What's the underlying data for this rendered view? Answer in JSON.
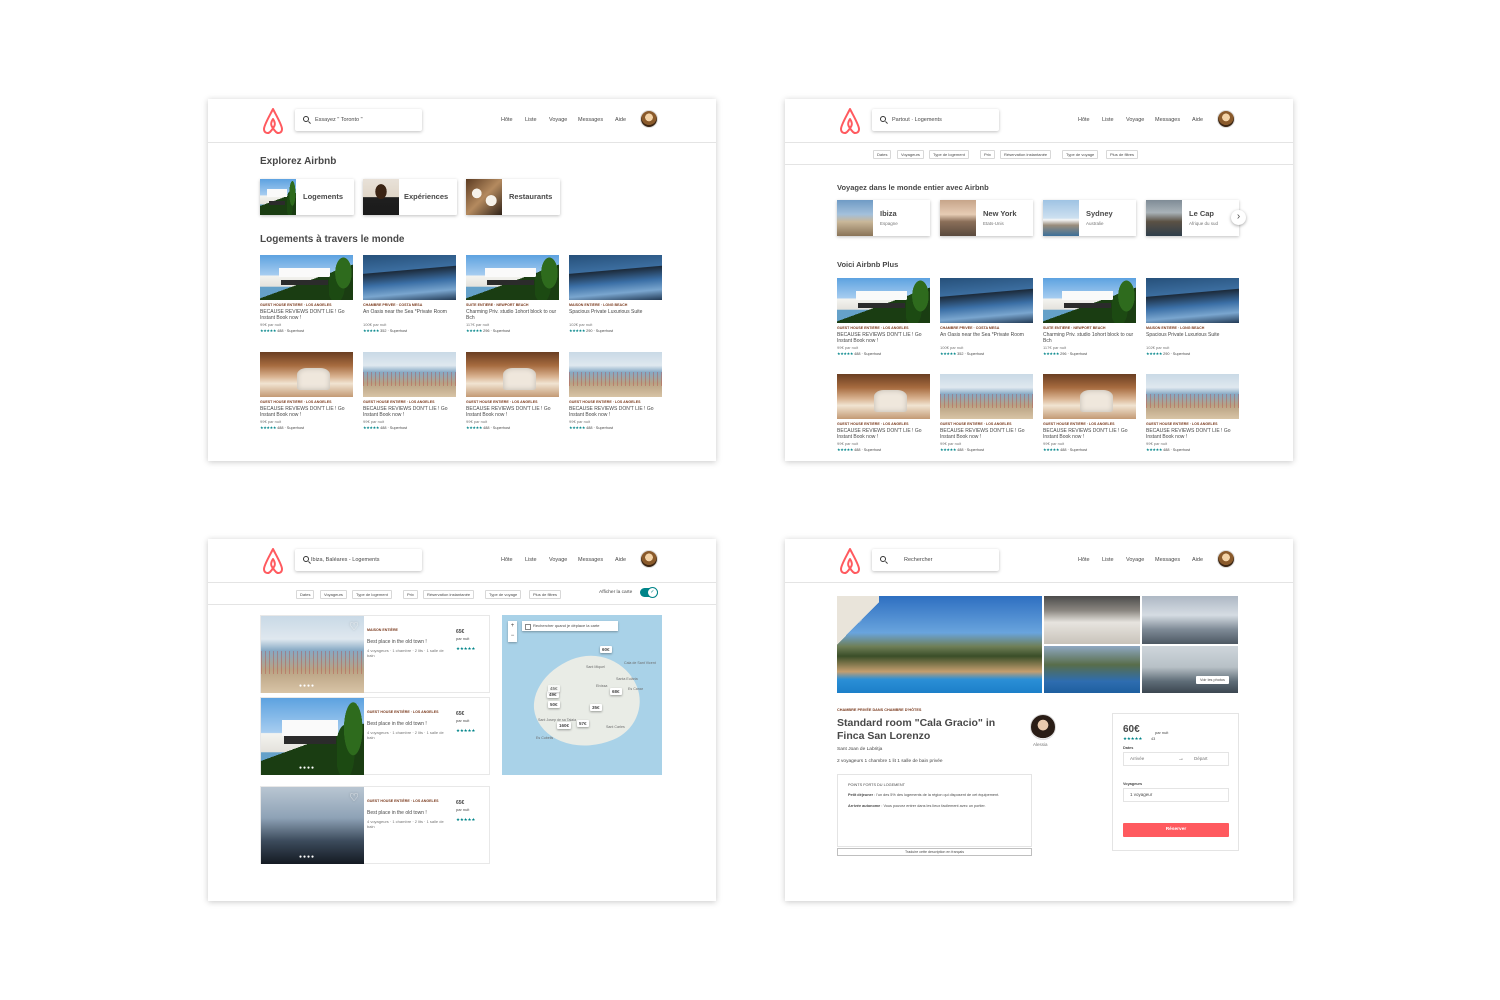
{
  "colors": {
    "brand": "#ff5a5f",
    "accent": "#008489",
    "category": "#7a3a1d",
    "text": "#484848"
  },
  "nav": [
    "Hôte",
    "Liste",
    "Voyage",
    "Messages",
    "Aide"
  ],
  "icons": [
    "airbnb-logo-icon",
    "search-icon",
    "heart-icon",
    "chevron-right-icon",
    "arrow-right-icon",
    "zoom-in-icon",
    "zoom-out-icon",
    "check-icon"
  ],
  "screen1": {
    "search_placeholder": "Essayez \" Toronto \"",
    "explore_title": "Explorez Airbnb",
    "categories": [
      "Logements",
      "Expériences",
      "Restaurants"
    ],
    "section_title": "Logements à travers le monde",
    "listings": [
      {
        "cat": "GUEST HOUSE ENTIÈRE · LOS ANGELES",
        "title": "BECAUSE REVIEWS DON'T LIE ! Go Instant Book now !",
        "price": "99€ par nuit",
        "stars": "★★★★★",
        "rating": "488 · Superhost"
      },
      {
        "cat": "CHAMBRE PRIVÉE · COSTA MESA",
        "title": "An Oasis near the Sea *Private Room",
        "price": "100€ par nuit",
        "stars": "★★★★★",
        "rating": "352 · Superhost"
      },
      {
        "cat": "SUITE ENTIÈRE · NEWPORT BEACH",
        "title": "Charming Priv. studio 1ohort block to our Bch",
        "price": "117€ par nuit",
        "stars": "★★★★★",
        "rating": "296 · Superhost"
      },
      {
        "cat": "MAISON ENTIÈRE · LONG BEACH",
        "title": "Spacious Private Luxurious Suite",
        "price": "102€ par nuit",
        "stars": "★★★★★",
        "rating": "290 · Superhost"
      },
      {
        "cat": "GUEST HOUSE ENTIÈRE · LOS ANGELES",
        "title": "BECAUSE REVIEWS DON'T LIE ! Go Instant Book now !",
        "price": "99€ par nuit",
        "stars": "★★★★★",
        "rating": "488 · Superhost"
      },
      {
        "cat": "GUEST HOUSE ENTIÈRE · LOS ANGELES",
        "title": "BECAUSE REVIEWS DON'T LIE ! Go Instant Book now !",
        "price": "99€ par nuit",
        "stars": "★★★★★",
        "rating": "488 · Superhost"
      },
      {
        "cat": "GUEST HOUSE ENTIÈRE · LOS ANGELES",
        "title": "BECAUSE REVIEWS DON'T LIE ! Go Instant Book now !",
        "price": "99€ par nuit",
        "stars": "★★★★★",
        "rating": "488 · Superhost"
      },
      {
        "cat": "GUEST HOUSE ENTIÈRE · LOS ANGELES",
        "title": "BECAUSE REVIEWS DON'T LIE ! Go Instant Book now !",
        "price": "99€ par nuit",
        "stars": "★★★★★",
        "rating": "488 · Superhost"
      }
    ]
  },
  "screen2": {
    "search_value": "Partout · Logements",
    "filters": [
      "Dates",
      "Voyageurs",
      "Type de logement",
      "Prix",
      "Réservation instantanée",
      "Type de voyage",
      "Plus de filtres"
    ],
    "world_title": "Voyagez dans le monde entier avec Airbnb",
    "cities": [
      {
        "name": "Ibiza",
        "country": "Espagne"
      },
      {
        "name": "New York",
        "country": "Etats-Unis"
      },
      {
        "name": "Sydney",
        "country": "Australie"
      },
      {
        "name": "Le Cap",
        "country": "Afrique du sud"
      }
    ],
    "plus_title": "Voici Airbnb Plus",
    "listings": [
      {
        "cat": "GUEST HOUSE ENTIÈRE · LOS ANGELES",
        "title": "BECAUSE REVIEWS DON'T LIE ! Go Instant Book now !",
        "price": "99€ par nuit",
        "stars": "★★★★★",
        "rating": "488 · Superhost"
      },
      {
        "cat": "CHAMBRE PRIVÉE · COSTA MESA",
        "title": "An Oasis near the Sea *Private Room",
        "price": "100€ par nuit",
        "stars": "★★★★★",
        "rating": "352 · Superhost"
      },
      {
        "cat": "SUITE ENTIÈRE · NEWPORT BEACH",
        "title": "Charming Priv. studio 1ohort block to our Bch",
        "price": "117€ par nuit",
        "stars": "★★★★★",
        "rating": "296 · Superhost"
      },
      {
        "cat": "MAISON ENTIÈRE · LONG BEACH",
        "title": "Spacious Private Luxurious Suite",
        "price": "102€ par nuit",
        "stars": "★★★★★",
        "rating": "290 · Superhost"
      },
      {
        "cat": "GUEST HOUSE ENTIÈRE · LOS ANGELES",
        "title": "BECAUSE REVIEWS DON'T LIE ! Go Instant Book now !",
        "price": "99€ par nuit",
        "stars": "★★★★★",
        "rating": "488 · Superhost"
      },
      {
        "cat": "GUEST HOUSE ENTIÈRE · LOS ANGELES",
        "title": "BECAUSE REVIEWS DON'T LIE ! Go Instant Book now !",
        "price": "99€ par nuit",
        "stars": "★★★★★",
        "rating": "488 · Superhost"
      },
      {
        "cat": "GUEST HOUSE ENTIÈRE · LOS ANGELES",
        "title": "BECAUSE REVIEWS DON'T LIE ! Go Instant Book now !",
        "price": "99€ par nuit",
        "stars": "★★★★★",
        "rating": "488 · Superhost"
      },
      {
        "cat": "GUEST HOUSE ENTIÈRE · LOS ANGELES",
        "title": "BECAUSE REVIEWS DON'T LIE ! Go Instant Book now !",
        "price": "99€ par nuit",
        "stars": "★★★★★",
        "rating": "488 · Superhost"
      }
    ]
  },
  "screen3": {
    "search_value": "Ibiza, Baléares - Logements",
    "filters": [
      "Dates",
      "Voyageurs",
      "Type de logement",
      "Prix",
      "Réservation instantanée",
      "Type de voyage",
      "Plus de filtres"
    ],
    "map_toggle_label": "Afficher la carte",
    "map_search_label": "Rechercher quand je déplace la carte",
    "listings": [
      {
        "cat": "MAISON ENTIÈRE",
        "title": "Best place in the old town !",
        "desc": "4 voyageurs · 1 chambre · 2 lits · 1 salle de bain",
        "price": "65€",
        "per": "par nuit",
        "stars": "★★★★★"
      },
      {
        "cat": "GUEST HOUSE ENTIÈRE · LOS ANGELES",
        "title": "Best place in the old town !",
        "desc": "4 voyageurs · 1 chambre · 2 lits · 1 salle de bain",
        "price": "65€",
        "per": "par nuit",
        "stars": "★★★★★"
      },
      {
        "cat": "GUEST HOUSE ENTIÈRE · LOS ANGELES",
        "title": "Best place in the old town !",
        "desc": "4 voyageurs · 1 chambre · 2 lits · 1 salle de bain",
        "price": "65€",
        "per": "par nuit",
        "stars": "★★★★★"
      }
    ],
    "pins": [
      "60€",
      "49€",
      "50€",
      "68€",
      "35€",
      "57€",
      "160€",
      "45€"
    ],
    "map_labels": [
      "Cala de Sant Vicent",
      "Sant Miquel",
      "Santa Eulària",
      "Sant Josep de sa Talaia",
      "Eivissa",
      "Es Canar",
      "Es Cubells",
      "Sant Carles"
    ]
  },
  "screen4": {
    "search_value": "Rechercher",
    "photos_button": "Voir les photos",
    "category": "CHAMBRE PRIVÉE DANS CHAMBRE D'HÔTES",
    "title": "Standard room \"Cala Gracio\" in Finca San Lorenzo",
    "location": "Sant Joan de Labritja",
    "features": "2 voyageurs   1 chambre   1 lit   1 salle de bain privée",
    "host_name": "Alessia",
    "points_title": "POINTS FORTS DU LOGEMENT",
    "point1_label": "Petit déjeuner",
    "point1_text": " : l'un des 5% des logements de la région qui disposent de cet équipement.",
    "point2_label": "Arrivée autonome",
    "point2_text": " : Vous pouvez entrer dans les lieux facilement avec un portier.",
    "translate": "Traduire cette description en français",
    "price": "60€",
    "per_night": "par nuit",
    "stars": "★★★★★",
    "reviews": "43",
    "dates_label": "Dates",
    "arrival": "Arrivée",
    "departure": "Départ",
    "travelers_label": "Voyageurs",
    "travelers_value": "1 voyageur",
    "book_button": "Réserver"
  }
}
